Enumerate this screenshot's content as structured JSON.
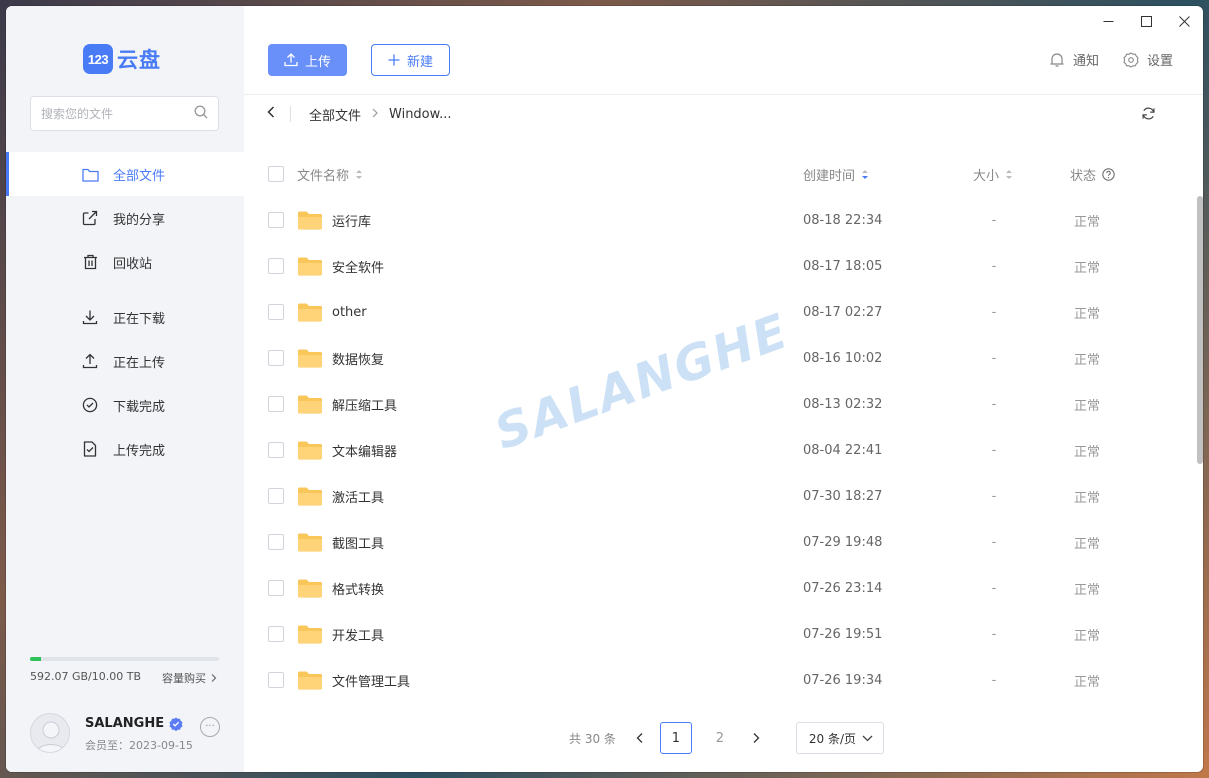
{
  "app": {
    "logo_badge": "123",
    "logo_text": "云盘",
    "accent_color": "#4a7bf7"
  },
  "search": {
    "placeholder": "搜索您的文件"
  },
  "sidebar": {
    "items": [
      {
        "label": "全部文件",
        "icon": "folder-icon",
        "active": true
      },
      {
        "label": "我的分享",
        "icon": "share-icon",
        "active": false
      },
      {
        "label": "回收站",
        "icon": "trash-icon",
        "active": false
      }
    ],
    "transfer_items": [
      {
        "label": "正在下载",
        "icon": "download-icon"
      },
      {
        "label": "正在上传",
        "icon": "upload-icon"
      },
      {
        "label": "下载完成",
        "icon": "check-circle-icon"
      },
      {
        "label": "上传完成",
        "icon": "file-check-icon"
      }
    ],
    "storage": {
      "used_text": "592.07 GB/10.00 TB",
      "used_fraction": 0.058,
      "buy_label": "容量购买"
    },
    "user": {
      "name": "SALANGHE",
      "vip_text": "会员至：2023-09-15"
    }
  },
  "toolbar": {
    "upload_label": "上传",
    "new_label": "新建",
    "notify_label": "通知",
    "settings_label": "设置"
  },
  "breadcrumb": {
    "root": "全部文件",
    "current": "Window..."
  },
  "table": {
    "headers": {
      "name": "文件名称",
      "date": "创建时间",
      "size": "大小",
      "status": "状态"
    },
    "rows": [
      {
        "name": "运行库",
        "date": "08-18 22:34",
        "size": "-",
        "status": "正常"
      },
      {
        "name": "安全软件",
        "date": "08-17 18:05",
        "size": "-",
        "status": "正常"
      },
      {
        "name": "other",
        "date": "08-17 02:27",
        "size": "-",
        "status": "正常"
      },
      {
        "name": "数据恢复",
        "date": "08-16 10:02",
        "size": "-",
        "status": "正常"
      },
      {
        "name": "解压缩工具",
        "date": "08-13 02:32",
        "size": "-",
        "status": "正常"
      },
      {
        "name": "文本编辑器",
        "date": "08-04 22:41",
        "size": "-",
        "status": "正常"
      },
      {
        "name": "激活工具",
        "date": "07-30 18:27",
        "size": "-",
        "status": "正常"
      },
      {
        "name": "截图工具",
        "date": "07-29 19:48",
        "size": "-",
        "status": "正常"
      },
      {
        "name": "格式转换",
        "date": "07-26 23:14",
        "size": "-",
        "status": "正常"
      },
      {
        "name": "开发工具",
        "date": "07-26 19:51",
        "size": "-",
        "status": "正常"
      },
      {
        "name": "文件管理工具",
        "date": "07-26 19:34",
        "size": "-",
        "status": "正常"
      }
    ]
  },
  "pagination": {
    "total_text": "共 30 条",
    "pages": [
      "1",
      "2"
    ],
    "current_page": "1",
    "page_size_text": "20 条/页"
  },
  "watermark": "SALANGHE"
}
